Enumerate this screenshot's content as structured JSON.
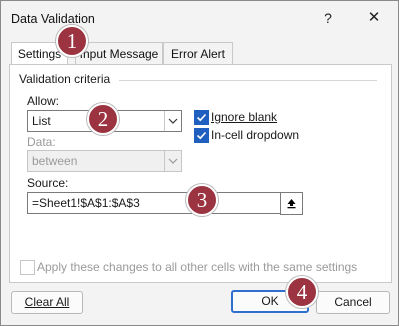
{
  "dialog": {
    "title": "Data Validation",
    "help_glyph": "?",
    "close_glyph": "✕"
  },
  "tabs": [
    {
      "label": "Settings",
      "active": true
    },
    {
      "label": "Input Message",
      "active": false
    },
    {
      "label": "Error Alert",
      "active": false
    }
  ],
  "criteria": {
    "group_label": "Validation criteria",
    "allow_label": "Allow:",
    "allow_value": "List",
    "data_label": "Data:",
    "data_value": "between",
    "ignore_blank_label": "Ignore blank",
    "ignore_blank_checked": true,
    "in_cell_dropdown_label": "In-cell dropdown",
    "in_cell_dropdown_checked": true,
    "source_label": "Source:",
    "source_value": "=Sheet1!$A$1:$A$3"
  },
  "apply_all": {
    "label": "Apply these changes to all other cells with the same settings",
    "checked": false
  },
  "buttons": {
    "clear_all": "Clear All",
    "ok": "OK",
    "cancel": "Cancel"
  },
  "annotations": [
    "1",
    "2",
    "3",
    "4"
  ],
  "colors": {
    "badge": "#9b3340",
    "checkbox_accent": "#1f5fbf",
    "default_button_border": "#2f6fcf"
  }
}
